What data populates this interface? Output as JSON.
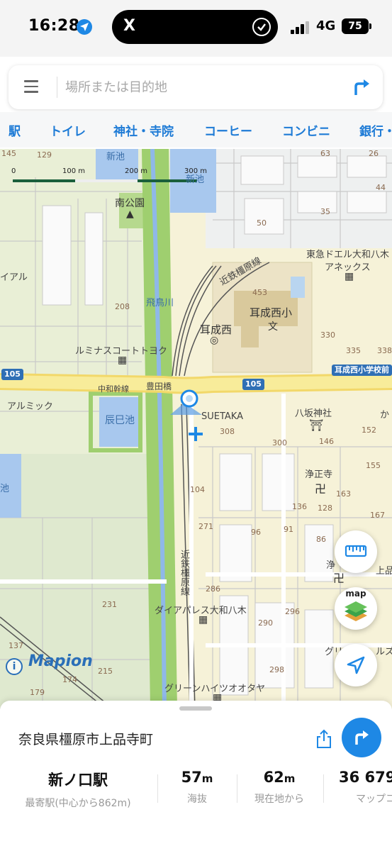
{
  "status_bar": {
    "time": "16:28",
    "island_icon": "X",
    "network": "4G",
    "battery": "75"
  },
  "search": {
    "placeholder": "場所または目的地"
  },
  "categories": [
    "駅",
    "トイレ",
    "神社・寺院",
    "コーヒー",
    "コンビニ",
    "銀行・"
  ],
  "map": {
    "scale": [
      "0",
      "100 m",
      "200 m",
      "300 m"
    ],
    "ponds": [
      "新池",
      "新池",
      "辰巳池"
    ],
    "park": "南公園",
    "school": "耳成西小",
    "school_mark": "文",
    "kindergarten": "耳成西",
    "railway_north": "近鉄橿原線",
    "railway_south": "近鉄橿原線",
    "river": "飛鳥川",
    "road_name": "中和幹線",
    "bridge": "豊田橋",
    "route_105_left": "105",
    "route_105_mid": "105",
    "bus_stop": "耳成西小学校前",
    "apartment_ne": "東急ドエル大和八木",
    "apartment_ne_2": "アネックス",
    "luminous": "ルミナスコートトヨク",
    "aeon_part": "イアル",
    "almick": "アルミック",
    "suetaka": "SUETAKA",
    "shrine": "八坂神社",
    "temple": "浄正寺",
    "temple_2": "浄",
    "temple_2_suffix": "上品",
    "daiapalace": "ダイアパレス大和八木",
    "green_heights": "グリーンハイツオオタヤ",
    "green_other": "グリー",
    "green_other_2": "ルズ",
    "kana": "か",
    "pond_edge": "池",
    "numbers": [
      "145",
      "129",
      "63",
      "26",
      "44",
      "35",
      "50",
      "453",
      "208",
      "330",
      "335",
      "338",
      "152",
      "308",
      "300",
      "146",
      "155",
      "104",
      "163",
      "136",
      "128",
      "167",
      "271",
      "96",
      "91",
      "86",
      "286",
      "231",
      "296",
      "290",
      "137",
      "174",
      "215",
      "298",
      "179"
    ],
    "attribution": "Mapion",
    "map_button": "map"
  },
  "place": {
    "address": "奈良県橿原市上品寺町",
    "stats": [
      {
        "value": "新ノ口駅",
        "unit": "",
        "label": "最寄駅(中心から862m)"
      },
      {
        "value": "57",
        "unit": "m",
        "label": "海抜"
      },
      {
        "value": "62",
        "unit": "m",
        "label": "現在地から"
      },
      {
        "value": "36 679",
        "unit": "",
        "label": "マップコ"
      }
    ]
  },
  "colors": {
    "accent": "#1e88e5",
    "chip_text": "#1e7bd6",
    "map_base": "#f6f2d8",
    "green_area": "#dfe9cf",
    "water": "#a8c8ee",
    "river_green": "#9fcf6f"
  }
}
